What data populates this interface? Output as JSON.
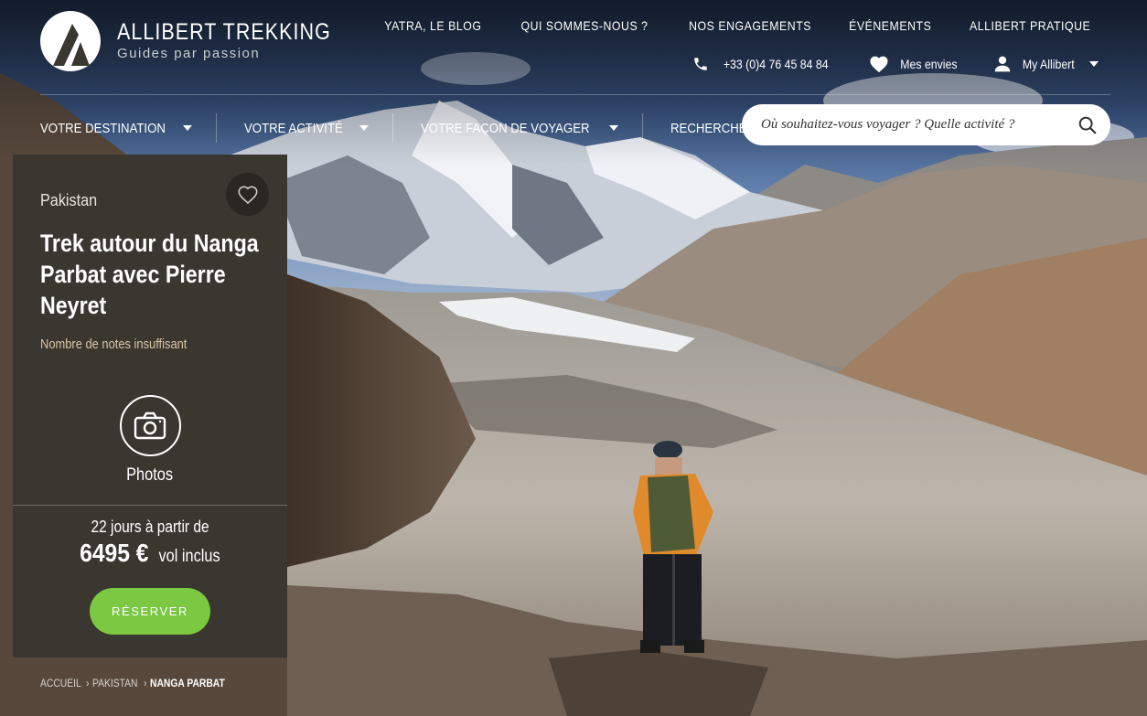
{
  "brand": {
    "name": "ALLIBERT TREKKING",
    "tagline": "Guides par passion"
  },
  "top_nav": [
    {
      "label": "YATRA, LE BLOG"
    },
    {
      "label": "QUI SOMMES-NOUS ?"
    },
    {
      "label": "NOS ENGAGEMENTS"
    },
    {
      "label": "ÉVÉNEMENTS"
    },
    {
      "label": "ALLIBERT PRATIQUE"
    }
  ],
  "utility": {
    "phone": "+33 (0)4 76 45 84 84",
    "wishlist": "Mes envies",
    "account": "My Allibert"
  },
  "main_nav": [
    {
      "label": "VOTRE DESTINATION"
    },
    {
      "label": "VOTRE ACTIVITÉ"
    },
    {
      "label": "VOTRE FAÇON DE VOYAGER"
    },
    {
      "label": "RECHERCHE AVANCÉE"
    }
  ],
  "search": {
    "placeholder": "Où souhaitez-vous voyager ? Quelle activité ?"
  },
  "product": {
    "country": "Pakistan",
    "title_lines": [
      "Trek autour du Nanga",
      "Parbat avec Pierre",
      "Neyret"
    ],
    "rating_text": "Nombre de notes insuffisant",
    "photos_label": "Photos",
    "duration_text": "22 jours à partir de",
    "price": "6495 €",
    "price_suffix": "vol inclus",
    "book_label": "RÉSERVER"
  },
  "breadcrumb": [
    {
      "label": "ACCUEIL"
    },
    {
      "label": "PAKISTAN"
    },
    {
      "label": "NANGA PARBAT"
    }
  ],
  "colors": {
    "card_bg": "#3a3630",
    "book_button": "#7bc843",
    "rating_text": "#d9c7a6"
  }
}
